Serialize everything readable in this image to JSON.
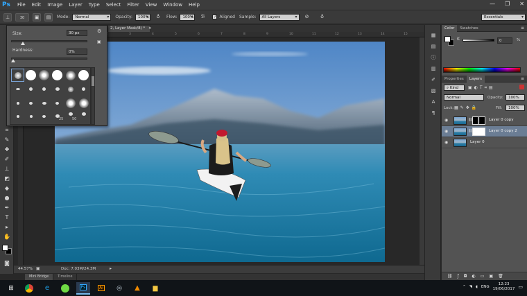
{
  "app": {
    "logo": "Ps",
    "menus": [
      "File",
      "Edit",
      "Image",
      "Layer",
      "Type",
      "Select",
      "Filter",
      "View",
      "Window",
      "Help"
    ],
    "window_controls": {
      "minimize": "—",
      "restore": "❐",
      "close": "✕"
    }
  },
  "options_bar": {
    "brush_size": "30",
    "mode_label": "Mode:",
    "mode_value": "Normal",
    "opacity_label": "Opacity:",
    "opacity_value": "100%",
    "flow_label": "Flow:",
    "flow_value": "100%",
    "aligned_label": "Aligned",
    "aligned_checked": "✓",
    "sample_label": "Sample:",
    "sample_value": "All Layers",
    "workspace": "Essentials"
  },
  "brush_popup": {
    "size_label": "Size:",
    "size_value": "30 px",
    "hardness_label": "Hardness:",
    "hardness_value": "0%",
    "size_slider_percent": 15,
    "hardness_slider_percent": 0,
    "tip_size_labels": [
      "25",
      "50"
    ]
  },
  "document": {
    "tab_title": "2, Layer Mask/8) *",
    "tab_close": "×",
    "ruler_numbers": [
      "1",
      "0",
      "1",
      "2",
      "3",
      "4",
      "5",
      "6",
      "7",
      "8",
      "9",
      "10",
      "11",
      "12",
      "13",
      "14",
      "15",
      "16"
    ]
  },
  "status_bar": {
    "zoom": "44.57%",
    "doc_info": "Doc: 7.03M/24.3M"
  },
  "bottom_tabs": [
    "Mini Bridge",
    "Timeline"
  ],
  "color_panel": {
    "tabs": [
      "Color",
      "Swatches"
    ],
    "channel_label": "K",
    "channel_value": "0",
    "channel_unit": "%"
  },
  "layers_panel": {
    "tabs": [
      "Properties",
      "Layers"
    ],
    "filter_kind": "Kind",
    "blend_mode": "Normal",
    "opacity_label": "Opacity:",
    "opacity_value": "100%",
    "lock_label": "Lock:",
    "fill_label": "Fill:",
    "fill_value": "100%",
    "layers": [
      {
        "name": "Layer 0 copy",
        "selected": false,
        "mask": "black"
      },
      {
        "name": "Layer 0 copy 2",
        "selected": true,
        "mask": "white"
      },
      {
        "name": "Layer 0",
        "selected": false,
        "mask": "none"
      }
    ],
    "footer_icons": [
      "link-icon",
      "fx-icon",
      "mask-icon",
      "adjustment-icon",
      "group-icon",
      "new-layer-icon",
      "trash-icon"
    ]
  },
  "taskbar": {
    "language": "ENG",
    "time": "12:23",
    "date": "19/06/2017"
  },
  "colors": {
    "accent_blue": "#31a8ff",
    "selected_layer": "#6b7d94"
  }
}
